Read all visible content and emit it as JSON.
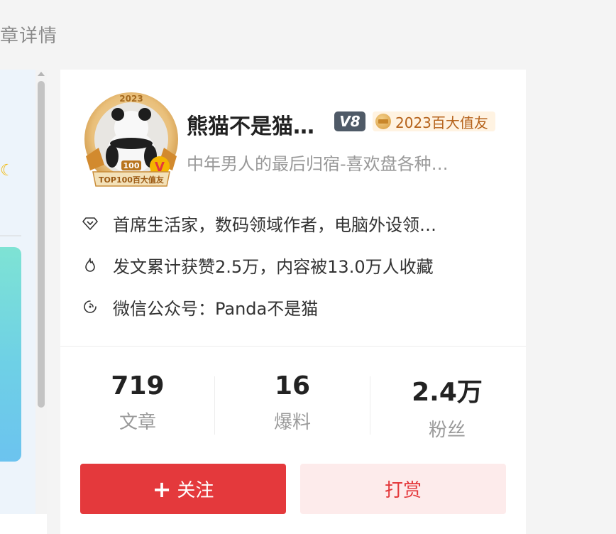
{
  "breadcrumb": {
    "text": "章详情"
  },
  "author": {
    "avatar_ring_year": "2023",
    "avatar_ribbon": "TOP100百大值友",
    "name": "熊猫不是猫…",
    "level": "V8",
    "badge_label": "2023百大值友",
    "subtitle": "中年男人的最后归宿-喜欢盘各种…"
  },
  "info": [
    {
      "icon": "diamond-icon",
      "text": "首席生活家，数码领域作者，电脑外设领…"
    },
    {
      "icon": "flame-icon",
      "text": "发文累计获赞2.5万，内容被13.0万人收藏"
    },
    {
      "icon": "link-icon",
      "text": "微信公众号：Panda不是猫"
    }
  ],
  "stats": [
    {
      "value": "719",
      "label": "文章"
    },
    {
      "value": "16",
      "label": "爆料"
    },
    {
      "value": "2.4万",
      "label": "粉丝"
    }
  ],
  "actions": {
    "follow_plus": "+",
    "follow_label": "关注",
    "tip_label": "打赏"
  },
  "colors": {
    "accent": "#e4393c",
    "tip_bg": "#fdebeb",
    "badge_text": "#b5621a",
    "level_bg": "#4f5a67"
  }
}
